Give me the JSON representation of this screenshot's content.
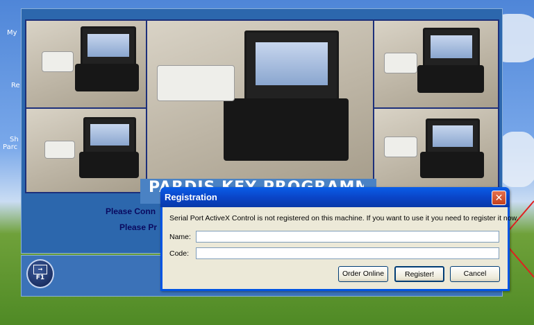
{
  "desktop": {
    "icon_labels": [
      "My",
      "Re",
      "Sh",
      "Parc"
    ]
  },
  "app": {
    "banner_title": "PARDIS KEY PROGRAMMER",
    "instruction_1": "Please Conn",
    "instruction_2": "Please Pr",
    "f1_label": "F1"
  },
  "dialog": {
    "title": "Registration",
    "close_glyph": "✕",
    "message": "Serial Port ActiveX Control is not registered on this machine. If you want to use it you need to register it now.",
    "name_label": "Name:",
    "name_value": "",
    "code_label": "Code:",
    "code_value": "",
    "order_online_label": "Order Online",
    "register_label": "Register!",
    "cancel_label": "Cancel"
  },
  "colors": {
    "annotation_arrow": "#e02020",
    "app_background": "#2c67ad",
    "dialog_title": "#0a45c8"
  },
  "icons": [
    "f1-help-icon",
    "close-icon"
  ]
}
